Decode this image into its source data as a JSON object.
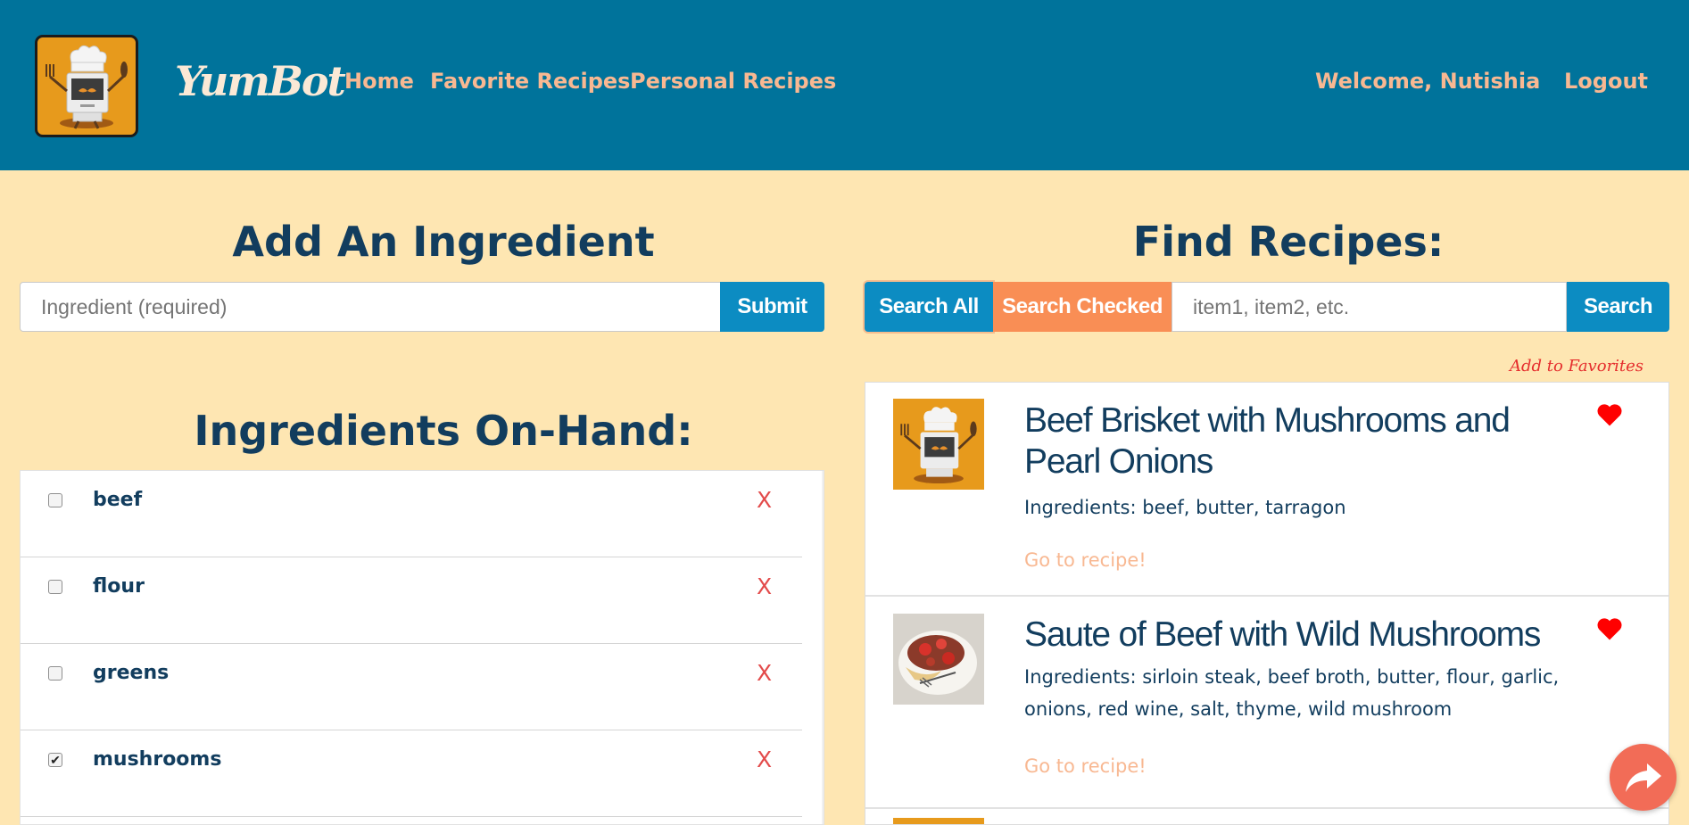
{
  "header": {
    "brand": "YumBot",
    "nav": [
      "Home",
      "Favorite Recipes",
      "Personal Recipes"
    ],
    "welcome": "Welcome, Nutishia",
    "logout": "Logout"
  },
  "add_ingredient": {
    "title": "Add An Ingredient",
    "placeholder": "Ingredient (required)",
    "submit_label": "Submit"
  },
  "ingredients": {
    "title": "Ingredients On-Hand:",
    "remove_glyph": "X",
    "items": [
      {
        "name": "beef",
        "checked": false
      },
      {
        "name": "flour",
        "checked": false
      },
      {
        "name": "greens",
        "checked": false
      },
      {
        "name": "mushrooms",
        "checked": true
      }
    ]
  },
  "find_recipes": {
    "title": "Find Recipes:",
    "search_all_label": "Search All",
    "search_checked_label": "Search Checked",
    "search_placeholder": "item1, item2, etc.",
    "search_label": "Search",
    "add_favorites": "Add to Favorites"
  },
  "recipes": [
    {
      "title": "Beef Brisket with Mushrooms and Pearl Onions",
      "ingredients": "Ingredients: beef, butter, tarragon",
      "link": "Go to recipe!",
      "favorited": true,
      "thumb_icon": "yumbot-logo"
    },
    {
      "title": "Saute of Beef with Wild Mushrooms",
      "ingredients": "Ingredients: sirloin steak, beef broth, butter, flour, garlic, onions, red wine, salt, thyme, wild mushroom",
      "link": "Go to recipe!",
      "favorited": true,
      "thumb_icon": "food-photo"
    }
  ],
  "colors": {
    "header_bg": "#00739b",
    "page_bg": "#fee6b2",
    "accent_blue": "#0c8cc2",
    "accent_orange": "#f98e55",
    "nav_text": "#f8b892",
    "title_text": "#123d5e",
    "heart": "#ff0000"
  },
  "icons": {
    "share": "share-icon",
    "heart": "heart-icon",
    "remove": "close-icon"
  }
}
